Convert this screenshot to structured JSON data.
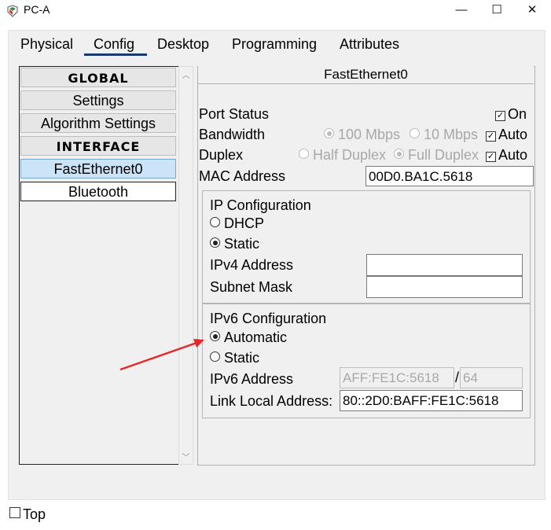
{
  "window": {
    "title": "PC-A",
    "minimize_glyph": "—",
    "maximize_glyph": "☐",
    "close_glyph": "✕"
  },
  "tabs": [
    {
      "label": "Physical"
    },
    {
      "label": "Config"
    },
    {
      "label": "Desktop"
    },
    {
      "label": "Programming"
    },
    {
      "label": "Attributes"
    }
  ],
  "sidebar": {
    "items": [
      {
        "label": "GLOBAL"
      },
      {
        "label": "Settings"
      },
      {
        "label": "Algorithm Settings"
      },
      {
        "label": "INTERFACE"
      },
      {
        "label": "FastEthernet0"
      },
      {
        "label": "Bluetooth"
      }
    ]
  },
  "panel": {
    "title": "FastEthernet0",
    "port_status": {
      "label": "Port Status",
      "on_label": "On",
      "checked": true
    },
    "bandwidth": {
      "label": "Bandwidth",
      "opt1": "100 Mbps",
      "opt2": "10 Mbps",
      "auto_label": "Auto",
      "auto_checked": true
    },
    "duplex": {
      "label": "Duplex",
      "opt1": "Half Duplex",
      "opt2": "Full Duplex",
      "auto_label": "Auto",
      "auto_checked": true
    },
    "mac": {
      "label": "MAC Address",
      "value": "00D0.BA1C.5618"
    },
    "ip_config": {
      "title": "IP Configuration",
      "dhcp_label": "DHCP",
      "static_label": "Static",
      "selected": "Static",
      "ipv4_label": "IPv4 Address",
      "ipv4_value": "",
      "subnet_label": "Subnet Mask",
      "subnet_value": ""
    },
    "ipv6_config": {
      "title": "IPv6 Configuration",
      "automatic_label": "Automatic",
      "static_label": "Static",
      "selected": "Automatic",
      "ipv6_label": "IPv6 Address",
      "ipv6_value": "AFF:FE1C:5618",
      "prefix_sep": "/",
      "prefix_value": "64",
      "link_local_label": "Link Local Address:",
      "link_local_value": "80::2D0:BAFF:FE1C:5618"
    }
  },
  "footer": {
    "top_label": "Top",
    "top_checked": false
  },
  "colors": {
    "annotation_arrow": "#e8262a",
    "tab_underline": "#1a3a6b",
    "selected_item": "#cce4f7"
  },
  "icons": {
    "app": "cisco-pt-icon",
    "scroll_up": "scroll-up-icon",
    "scroll_down": "scroll-down-icon"
  }
}
